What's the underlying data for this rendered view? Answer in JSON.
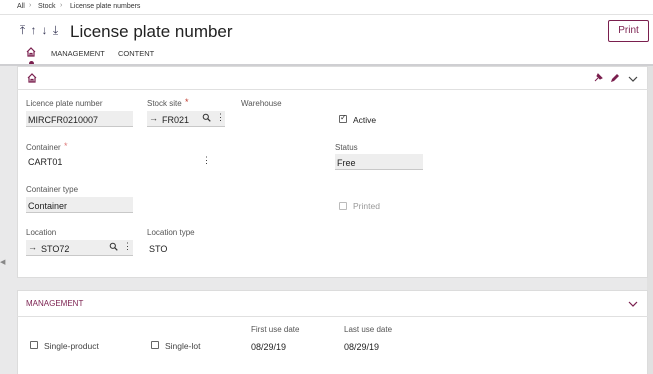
{
  "breadcrumb": {
    "items": [
      "All",
      "Stock",
      "License plate numbers"
    ]
  },
  "header": {
    "nav_arrows": [
      "⤒",
      "↑",
      "↓",
      "⤓"
    ],
    "title": "License plate number",
    "print_label": "Print",
    "tabs": [
      "MANAGEMENT",
      "CONTENT"
    ]
  },
  "main": {
    "lpn_label": "Licence plate number",
    "lpn_value": "MIRCFR0210007",
    "stock_site_label": "Stock site",
    "stock_site_required": "*",
    "stock_site_value": "FR021",
    "warehouse_label": "Warehouse",
    "active_label": "Active",
    "active_checked": true,
    "container_label": "Container",
    "container_required": "*",
    "container_value": "CART01",
    "status_label": "Status",
    "status_value": "Free",
    "container_type_label": "Container type",
    "container_type_value": "Container",
    "printed_label": "Printed",
    "printed_checked": false,
    "location_label": "Location",
    "location_value": "STO72",
    "location_type_label": "Location type",
    "location_type_value": "STO"
  },
  "management": {
    "title": "MANAGEMENT",
    "single_product_label": "Single-product",
    "single_lot_label": "Single-lot",
    "first_use_label": "First use date",
    "first_use_value": "08/29/19",
    "last_use_label": "Last use date",
    "last_use_value": "08/29/19"
  },
  "icons": {
    "link_arrow": "→",
    "search": "🔍",
    "kebab": "⋮",
    "chevron_down": "⌄"
  },
  "colors": {
    "accent": "#7a1f4e",
    "background": "#e9e9ea",
    "panel": "#ffffff",
    "field": "#eeeeee"
  }
}
